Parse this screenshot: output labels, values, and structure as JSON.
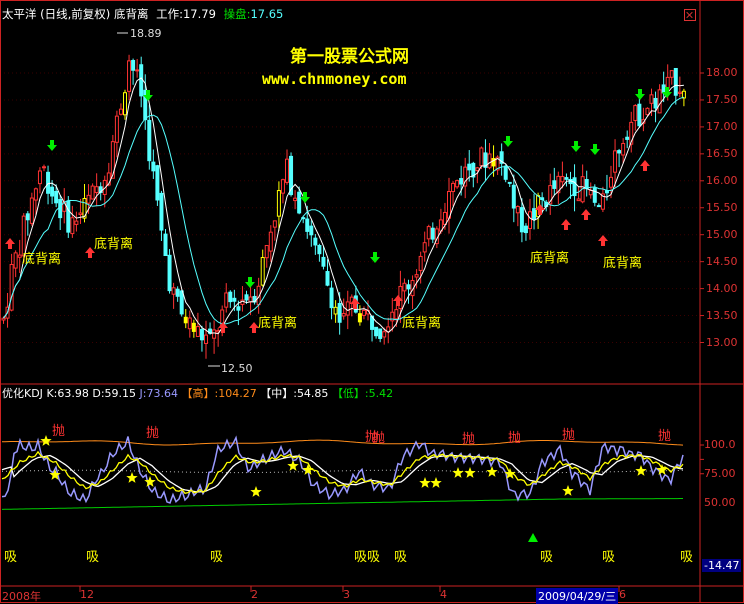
{
  "header": {
    "stock_name": "太平洋",
    "mode": "(日线,前复权)",
    "indicator": "底背离",
    "work_label": "工作:",
    "work_value": "17.79",
    "op_label": "操盘:",
    "op_value": "17.65"
  },
  "watermark": {
    "title": "第一股票公式网",
    "url": "www.chnmoney.com"
  },
  "price_axis": {
    "ticks": [
      "18.00",
      "17.50",
      "17.00",
      "16.50",
      "16.00",
      "15.50",
      "15.00",
      "14.50",
      "14.00",
      "13.50",
      "13.00"
    ],
    "values": [
      18.0,
      17.5,
      17.0,
      16.5,
      16.0,
      15.5,
      15.0,
      14.5,
      14.0,
      13.5,
      13.0
    ]
  },
  "price_marks": {
    "high": "18.89",
    "low": "12.50"
  },
  "divergence_labels": [
    "底背离",
    "底背离",
    "底背离",
    "底背离",
    "底背离",
    "底背离"
  ],
  "kdj": {
    "name": "优化KDJ",
    "k_label": "K:",
    "k_value": "63.98",
    "d_label": "D:",
    "d_value": "59.15",
    "j_label": "J:",
    "j_value": "73.64",
    "high_label": "【高】:",
    "high_value": "104.27",
    "mid_label": "【中】:",
    "mid_value": "54.85",
    "low_label": "【低】:",
    "low_value": "5.42",
    "axis_ticks": [
      "100.0",
      "75.00",
      "50.00"
    ],
    "axis_values": [
      100,
      75,
      50
    ],
    "current_low": "-14.47",
    "throw_label": "抛",
    "absorb_label": "吸",
    "absorb_double": "吸吸"
  },
  "date_axis": {
    "labels": [
      "2008年",
      "12",
      "2",
      "3",
      "4",
      "6"
    ],
    "cursor_date": "2009/04/29/三"
  },
  "colors": {
    "up": "#ff3333",
    "down": "#55ffff",
    "ma_short": "#ffffff",
    "ma_long": "#55ffff",
    "k_line": "#ffff00",
    "d_line": "#ffffff",
    "j_line": "#9999ff",
    "high_line": "#ff8c1a",
    "low_line": "#00cc00",
    "axis": "#cc2222"
  },
  "chart_data": {
    "type": "candlestick",
    "title": "",
    "ylim": [
      12.5,
      19.0
    ],
    "k_series_ylim": [
      -20,
      110
    ]
  }
}
